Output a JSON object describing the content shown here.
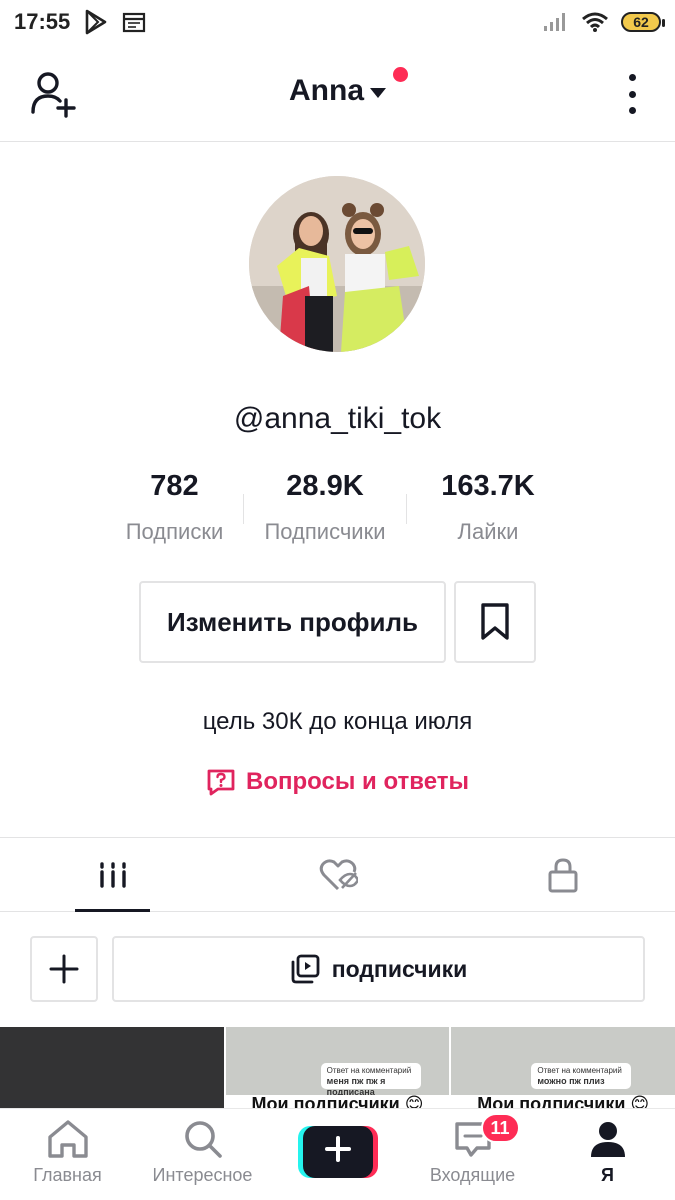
{
  "status_bar": {
    "time": "17:55",
    "battery": "62"
  },
  "header": {
    "title": "Anna"
  },
  "profile": {
    "username": "@anna_tiki_tok",
    "stats": [
      {
        "value": "782",
        "label": "Подписки"
      },
      {
        "value": "28.9K",
        "label": "Подписчики"
      },
      {
        "value": "163.7K",
        "label": "Лайки"
      }
    ],
    "edit_button": "Изменить профиль",
    "bio": "цель 30К до конца июля",
    "qa_link": "Вопросы и ответы"
  },
  "playlist": {
    "label": "подписчики"
  },
  "videos": [
    {
      "style": "dark"
    },
    {
      "style": "light",
      "card_line1": "Ответ на комментарий",
      "card_line2": "меня пж пж я подписана",
      "caption": "Мои подписчики 😊"
    },
    {
      "style": "light",
      "card_line1": "Ответ на комментарий",
      "card_line2": "можно пж плиз",
      "caption": "Мои подписчики 😊"
    }
  ],
  "bottom_nav": {
    "home": "Главная",
    "discover": "Интересное",
    "inbox": "Входящие",
    "inbox_badge": "11",
    "me": "Я"
  },
  "colors": {
    "accent": "#fe2c55",
    "qa": "#e0245e",
    "text": "#161823",
    "muted": "#8a8b91"
  }
}
